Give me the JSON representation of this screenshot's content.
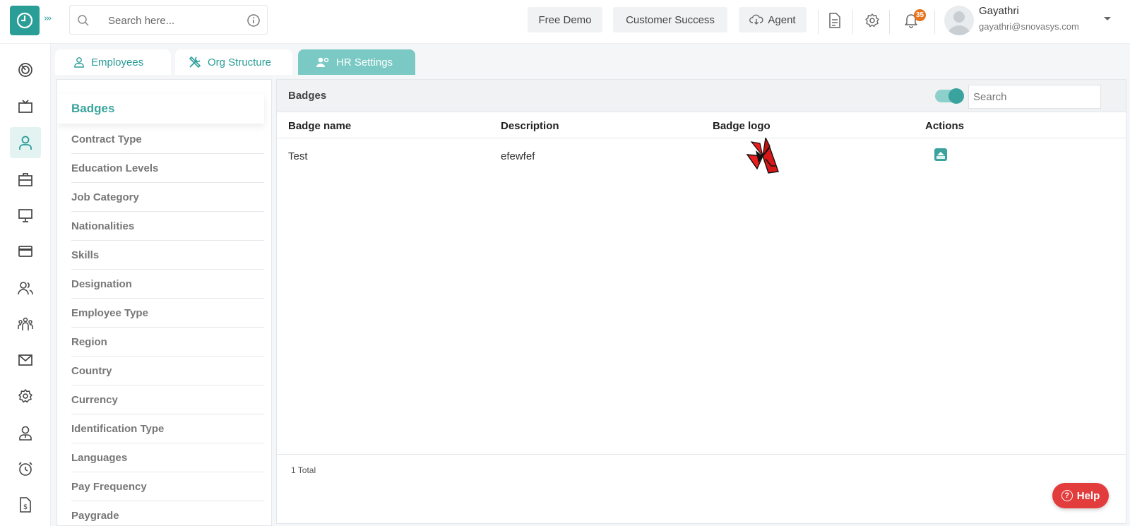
{
  "header": {
    "search_placeholder": "Search here...",
    "buttons": {
      "free_demo": "Free Demo",
      "customer_success": "Customer Success",
      "agent": "Agent"
    },
    "notifications_count": "35",
    "user": {
      "name": "Gayathri",
      "email": "gayathri@snovasys.com"
    }
  },
  "tabs": [
    {
      "label": "Employees",
      "icon": "person-icon"
    },
    {
      "label": "Org Structure",
      "icon": "tools-icon"
    },
    {
      "label": "HR Settings",
      "icon": "users-gear-icon"
    }
  ],
  "sidebar": {
    "items": [
      {
        "icon": "dashboard-icon"
      },
      {
        "icon": "tv-icon"
      },
      {
        "icon": "person-icon",
        "active": true
      },
      {
        "icon": "briefcase-icon"
      },
      {
        "icon": "monitor-icon"
      },
      {
        "icon": "card-icon"
      },
      {
        "icon": "people-icon"
      },
      {
        "icon": "team-icon"
      },
      {
        "icon": "mail-icon"
      },
      {
        "icon": "gear-icon"
      },
      {
        "icon": "user-badge-icon"
      },
      {
        "icon": "alarm-icon"
      },
      {
        "icon": "invoice-icon"
      }
    ]
  },
  "settings_menu": {
    "active": "Badges",
    "items": [
      "Contract Type",
      "Education Levels",
      "Job Category",
      "Nationalities",
      "Skills",
      "Designation",
      "Employee Type",
      "Region",
      "Country",
      "Currency",
      "Identification Type",
      "Languages",
      "Pay Frequency",
      "Paygrade"
    ]
  },
  "badges_panel": {
    "title": "Badges",
    "search_placeholder": "Search",
    "columns": [
      "Badge name",
      "Description",
      "Badge logo",
      "Actions"
    ],
    "rows": [
      {
        "name": "Test",
        "description": "efewfef",
        "logo": "red-butterfly-image",
        "action": "archive-icon"
      }
    ],
    "total_label": "1 Total"
  },
  "help": {
    "label": "Help"
  },
  "colors": {
    "accent": "#2a9d97",
    "tab_active": "#7ac9c4",
    "help": "#e23c3c",
    "notification": "#e8731e"
  }
}
